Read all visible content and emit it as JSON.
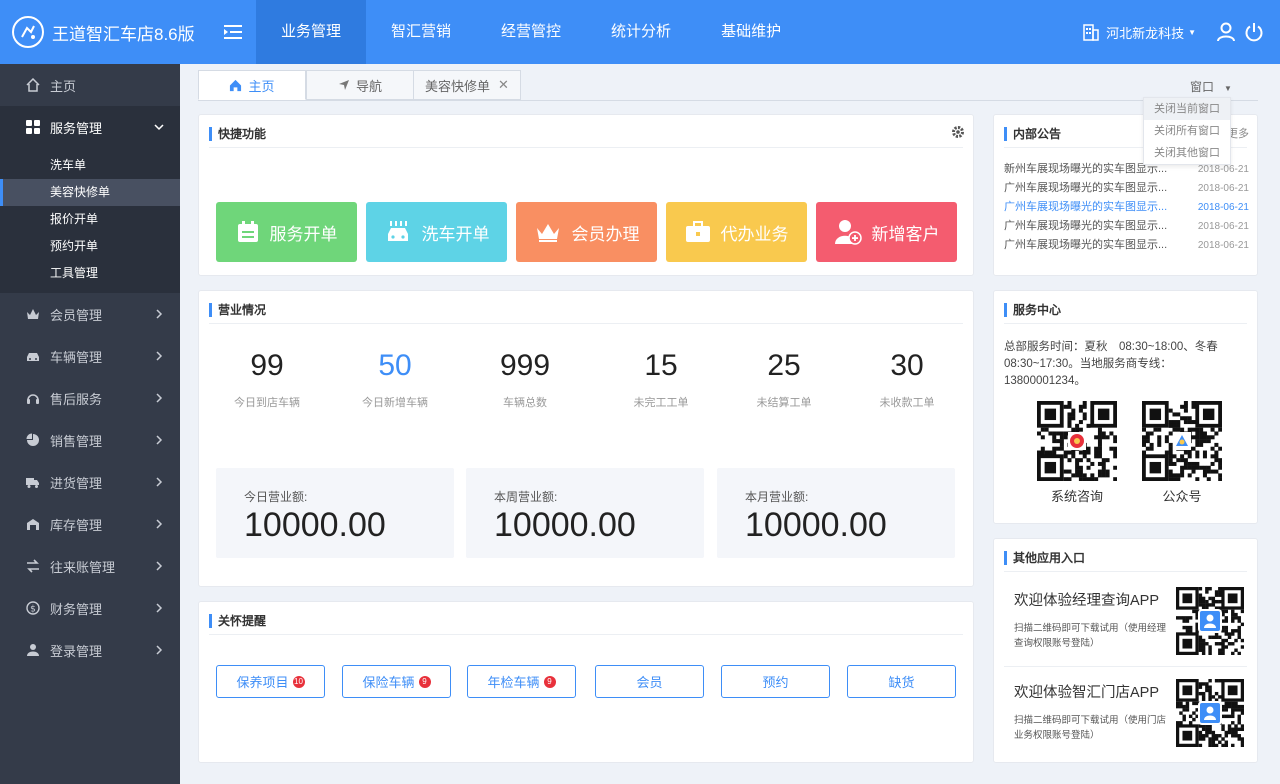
{
  "header": {
    "app_title": "王道智汇车店8.6版",
    "nav": [
      "业务管理",
      "智汇营销",
      "经营管控",
      "统计分析",
      "基础维护"
    ],
    "active_nav": 0,
    "company": "河北新龙科技",
    "accent": "#3e8ef7"
  },
  "sidebar": {
    "home": "主页",
    "open_group": "服务管理",
    "sub_items": [
      "洗车单",
      "美容快修单",
      "报价开单",
      "预约开单",
      "工具管理"
    ],
    "active_sub": 1,
    "groups": [
      "会员管理",
      "车辆管理",
      "售后服务",
      "销售管理",
      "进货管理",
      "库存管理",
      "往来账管理",
      "财务管理",
      "登录管理"
    ]
  },
  "tabs": {
    "items": [
      "主页",
      "导航",
      "美容快修单"
    ],
    "active": 0,
    "window_menu": "窗口",
    "window_options": [
      "关闭当前窗口",
      "关闭所有窗口",
      "关闭其他窗口"
    ]
  },
  "quick": {
    "title": "快捷功能",
    "buttons": [
      {
        "label": "服务开单",
        "color": "#6fd67a"
      },
      {
        "label": "洗车开单",
        "color": "#5ed3e6"
      },
      {
        "label": "会员办理",
        "color": "#f98f62"
      },
      {
        "label": "代办业务",
        "color": "#f9c94e"
      },
      {
        "label": "新增客户",
        "color": "#f45c6f"
      }
    ]
  },
  "business": {
    "title": "营业情况",
    "stats": [
      {
        "value": "99",
        "label": "今日到店车辆"
      },
      {
        "value": "50",
        "label": "今日新增车辆"
      },
      {
        "value": "999",
        "label": "车辆总数"
      },
      {
        "value": "15",
        "label": "未完工工单"
      },
      {
        "value": "25",
        "label": "未结算工单"
      },
      {
        "value": "30",
        "label": "未收款工单"
      }
    ],
    "revenue": [
      {
        "label": "今日营业额:",
        "value": "10000.00"
      },
      {
        "label": "本周营业额:",
        "value": "10000.00"
      },
      {
        "label": "本月营业额:",
        "value": "10000.00"
      }
    ]
  },
  "care": {
    "title": "关怀提醒",
    "buttons": [
      {
        "label": "保养项目",
        "badge": "10"
      },
      {
        "label": "保险车辆",
        "badge": "9"
      },
      {
        "label": "年检车辆",
        "badge": "9"
      },
      {
        "label": "会员",
        "badge": ""
      },
      {
        "label": "预约",
        "badge": ""
      },
      {
        "label": "缺货",
        "badge": ""
      }
    ]
  },
  "notices": {
    "title": "内部公告",
    "more": "更多",
    "items": [
      {
        "text": "新州车展现场曝光的实车图显示...",
        "date": "2018-06-21"
      },
      {
        "text": "广州车展现场曝光的实车图显示...",
        "date": "2018-06-21"
      },
      {
        "text": "广州车展现场曝光的实车图显示...",
        "date": "2018-06-21"
      },
      {
        "text": "广州车展现场曝光的实车图显示...",
        "date": "2018-06-21"
      },
      {
        "text": "广州车展现场曝光的实车图显示...",
        "date": "2018-06-21"
      }
    ],
    "highlight": 2
  },
  "service": {
    "title": "服务中心",
    "text": "总部服务时间：夏秋　08:30~18:00、冬春　08:30~17:30。当地服务商专线：13800001234。",
    "qr_labels": [
      "系统咨询",
      "公众号"
    ]
  },
  "apps": {
    "title": "其他应用入口",
    "items": [
      {
        "title": "欢迎体验经理查询APP",
        "desc": "扫描二维码即可下载试用（使用经理查询权限账号登陆）"
      },
      {
        "title": "欢迎体验智汇门店APP",
        "desc": "扫描二维码即可下载试用（使用门店业务权限账号登陆）"
      }
    ]
  }
}
